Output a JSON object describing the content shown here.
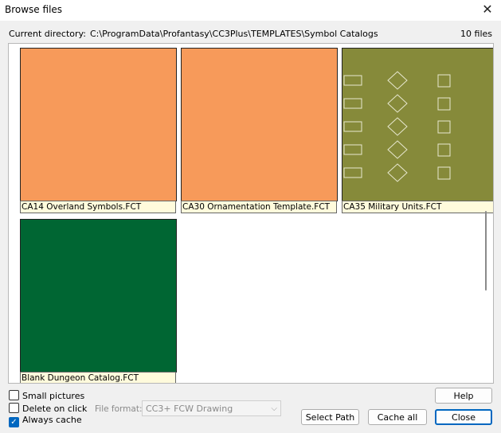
{
  "window": {
    "title": "Browse files",
    "close_glyph": "✕"
  },
  "directory": {
    "label": "Current directory:",
    "path": "C:\\ProgramData\\Profantasy\\CC3Plus\\TEMPLATES\\Symbol Catalogs",
    "count": "10 files"
  },
  "files": [
    {
      "name": "CA14 Overland Symbols.FCT",
      "color": "#f79a5a"
    },
    {
      "name": "CA30 Ornamentation Template.FCT",
      "color": "#f79a5a"
    },
    {
      "name": "CA35 Military Units.FCT",
      "color": "#868a3a"
    },
    {
      "name": "Blank Dungeon Catalog.FCT",
      "color": "#006633"
    }
  ],
  "options": {
    "small_pictures": {
      "label": "Small pictures",
      "checked": false
    },
    "delete_on_click": {
      "label": "Delete on click",
      "checked": false
    },
    "always_cache": {
      "label": "Always cache",
      "checked": true
    }
  },
  "file_format": {
    "label": "File format:",
    "value": "CC3+ FCW Drawing",
    "icon": "chevron-down-icon"
  },
  "buttons": {
    "help": "Help",
    "select_path": "Select Path",
    "cache_all": "Cache all",
    "close": "Close"
  },
  "colors": {
    "accent": "#0067c0",
    "label_bg": "#fffbdc"
  }
}
